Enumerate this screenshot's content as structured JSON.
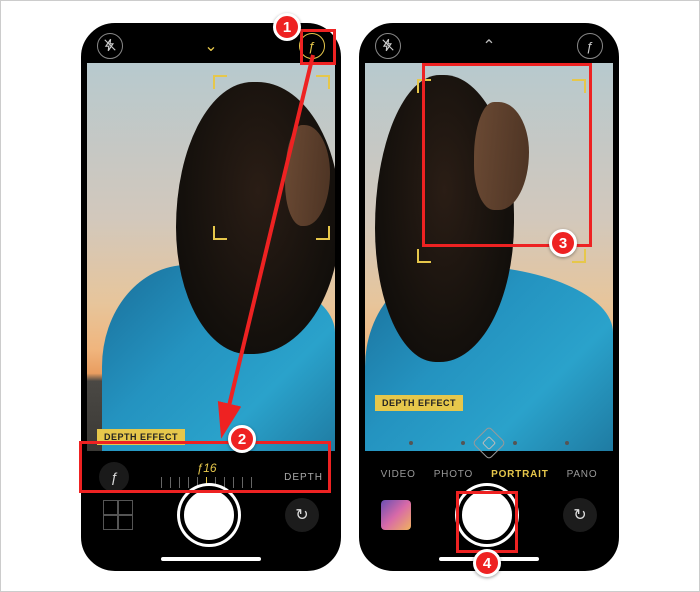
{
  "screens": {
    "left": {
      "aperture_label": "ƒ16",
      "depth_label": "DEPTH",
      "depth_effect_badge": "DEPTH EFFECT"
    },
    "right": {
      "depth_effect_badge": "DEPTH EFFECT",
      "modes": [
        "VIDEO",
        "PHOTO",
        "PORTRAIT",
        "PANO"
      ],
      "active_mode_index": 2
    }
  },
  "icons": {
    "flash_off": "✕",
    "chevron_down": "⌄",
    "chevron_up": "⌃",
    "aperture_f": "ƒ",
    "switch_camera": "↻"
  },
  "annotations": {
    "step1": "1",
    "step2": "2",
    "step3": "3",
    "step4": "4"
  }
}
